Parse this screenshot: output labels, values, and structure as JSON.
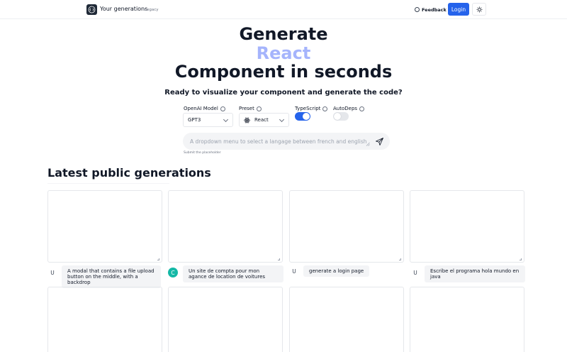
{
  "header": {
    "brand": "Your generations",
    "legacy": "Legacy",
    "feedback": "Feedback",
    "login": "Login"
  },
  "hero": {
    "line1": "Generate",
    "line2": "React",
    "line3": "Component in seconds",
    "subtitle": "Ready to visualize your component and generate the code?"
  },
  "options": {
    "model_label": "OpenAI Model",
    "model_value": "GPT3",
    "preset_label": "Preset",
    "preset_value": "React",
    "typescript_label": "TypeScript",
    "typescript_on": true,
    "autodeps_label": "AutoDeps",
    "autodeps_on": false
  },
  "prompt": {
    "placeholder": "A dropdown menu to select a langage between french and english",
    "hint": "Submit the placeholder"
  },
  "section_title": "Latest public generations",
  "generations": [
    {
      "avatar": "U",
      "prompt": "A modal that contains a file upload button on the middle, with a backdrop"
    },
    {
      "avatar": "C",
      "prompt": "Un site de compta pour mon agance de location de voitures"
    },
    {
      "avatar": "U",
      "prompt": "generate a login page"
    },
    {
      "avatar": "U",
      "prompt": "Escribe el programa hola mundo en java"
    }
  ],
  "colors": {
    "accent": "#2563eb",
    "hero_highlight": "#a5b4fc",
    "avatar_image": "#14b8a6"
  }
}
